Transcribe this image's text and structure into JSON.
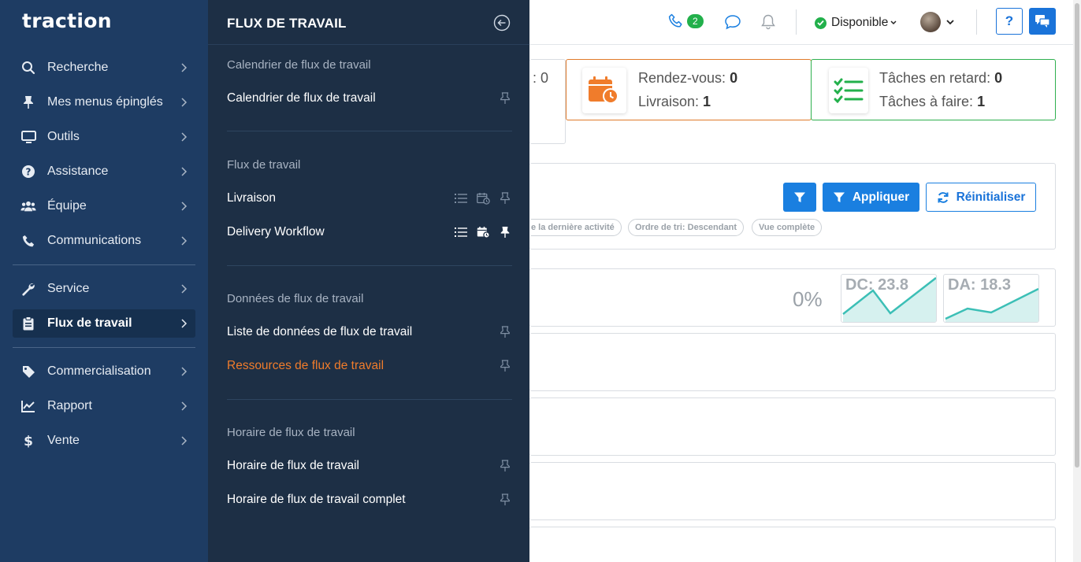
{
  "brand": {
    "logo_text": "traction"
  },
  "sidebar": {
    "items": [
      {
        "label": "Recherche",
        "icon": "search-icon"
      },
      {
        "label": "Mes menus épinglés",
        "icon": "pin-icon"
      },
      {
        "label": "Outils",
        "icon": "monitor-icon"
      },
      {
        "label": "Assistance",
        "icon": "question-icon"
      },
      {
        "label": "Équipe",
        "icon": "team-icon"
      },
      {
        "label": "Communications",
        "icon": "phone-icon"
      },
      {
        "label": "Service",
        "icon": "wrench-icon"
      },
      {
        "label": "Flux de travail",
        "icon": "clipboard-icon",
        "active": true
      },
      {
        "label": "Commercialisation",
        "icon": "tag-icon"
      },
      {
        "label": "Rapport",
        "icon": "chart-icon"
      },
      {
        "label": "Vente",
        "icon": "dollar-icon"
      }
    ]
  },
  "flyout": {
    "title": "FLUX DE TRAVAIL",
    "sections": [
      {
        "heading": "Calendrier de flux de travail",
        "items": [
          {
            "label": "Calendrier de flux de travail"
          }
        ]
      },
      {
        "heading": "Flux de travail",
        "items": [
          {
            "label": "Livraison"
          },
          {
            "label": "Delivery Workflow"
          }
        ]
      },
      {
        "heading": "Données de flux de travail",
        "items": [
          {
            "label": "Liste de données de flux de travail"
          },
          {
            "label": "Ressources de flux de travail",
            "highlight": true
          }
        ]
      },
      {
        "heading": "Horaire de flux de travail",
        "items": [
          {
            "label": "Horaire de flux de travail"
          },
          {
            "label": "Horaire de flux de travail complet"
          }
        ]
      }
    ]
  },
  "topbar": {
    "call_count": "2",
    "status": "Disponible"
  },
  "cards": {
    "partial_value": ": 0",
    "appointments": {
      "line1_label": "Rendez-vous: ",
      "line1_value": "0",
      "line2_label": "Livraison: ",
      "line2_value": "1"
    },
    "tasks": {
      "line1_label": "Tâches en retard: ",
      "line1_value": "0",
      "line2_label": "Tâches à faire: ",
      "line2_value": "1"
    }
  },
  "filters": {
    "apply_label": "Appliquer",
    "reset_label": "Réinitialiser",
    "chips": [
      "e la dernière activité",
      "Ordre de tri: Descendant",
      "Vue complète"
    ]
  },
  "stats": {
    "percent": "0%",
    "dc_label": "DC: 23.8",
    "da_label": "DA: 18.3"
  },
  "colors": {
    "sidebar_bg": "#1e3c63",
    "flyout_bg": "#1d2f45",
    "accent_blue": "#1a7fe0",
    "highlight_orange": "#f07c2b",
    "success_green": "#22b04b",
    "sparkline_teal": "#3cbfb6"
  }
}
